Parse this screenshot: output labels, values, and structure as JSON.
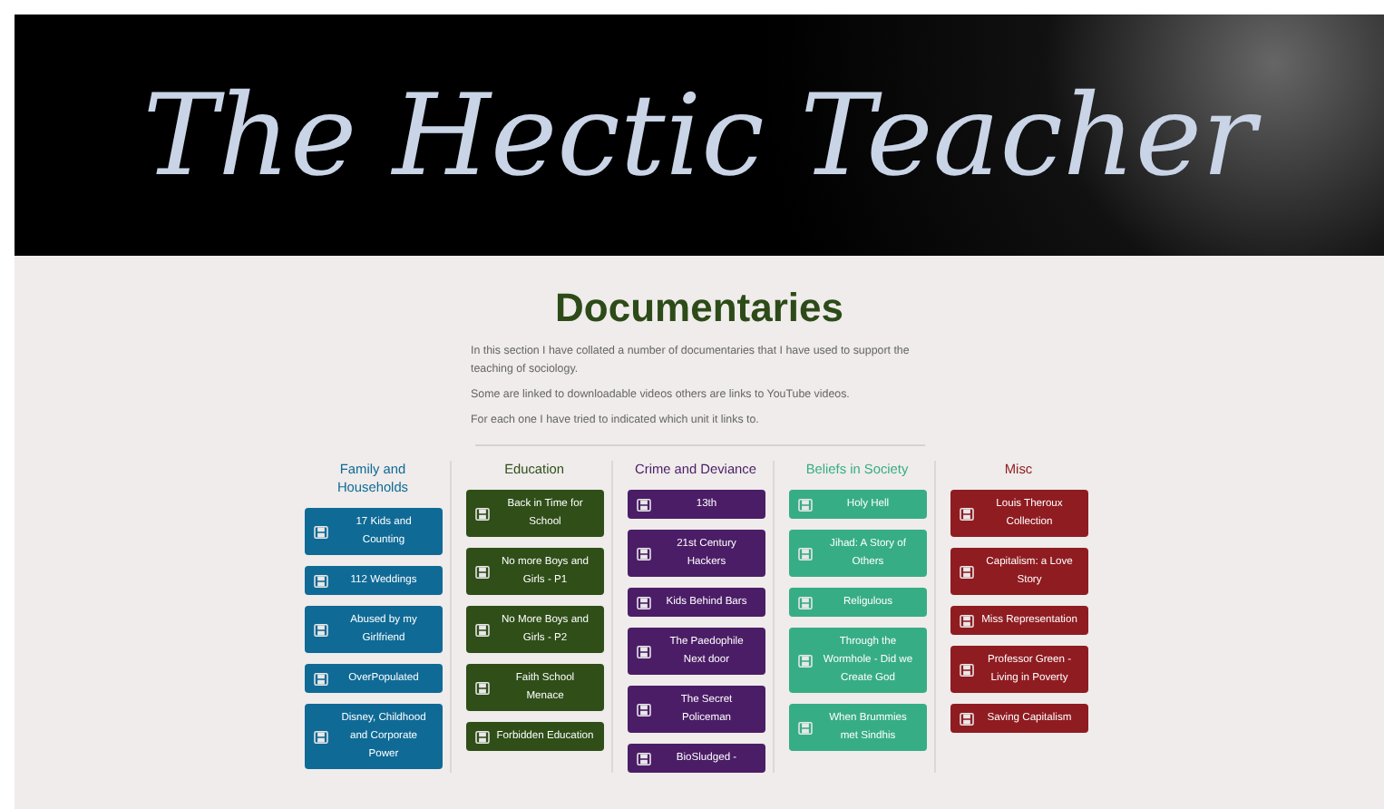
{
  "banner": {
    "title": "The Hectic Teacher"
  },
  "heading": "Documentaries",
  "intro": [
    "In this section I have collated a number of documentaries that I have used to support the teaching of sociology.",
    "Some are linked to downloadable videos others are links to YouTube videos.",
    "For each one I have tried to indicated which unit it links to."
  ],
  "columns": [
    {
      "title": "Family and Households",
      "color": "#0f6a96",
      "items": [
        "17 Kids and Counting",
        "112 Weddings",
        "Abused by my Girlfriend",
        "OverPopulated",
        "Disney, Childhood and Corporate Power"
      ]
    },
    {
      "title": "Education",
      "color": "#2f4e18",
      "items": [
        "Back in Time for School",
        "No more Boys and Girls - P1",
        "No More Boys and Girls - P2",
        "Faith School Menace",
        "Forbidden Education"
      ]
    },
    {
      "title": "Crime and Deviance",
      "color": "#4b1d66",
      "items": [
        "13th",
        "21st Century Hackers",
        "Kids Behind Bars",
        "The Paedophile Next door",
        "The Secret Policeman",
        "BioSludged -"
      ]
    },
    {
      "title": "Beliefs in Society",
      "color": "#37ad86",
      "items": [
        "Holy Hell",
        "Jihad: A Story of Others",
        "Religulous",
        "Through the Wormhole - Did we Create God",
        "When Brummies met Sindhis"
      ]
    },
    {
      "title": "Misc",
      "color": "#8f1c21",
      "items": [
        "Louis Theroux Collection",
        "Capitalism: a Love Story",
        "Miss Representation",
        "Professor Green - Living in Poverty",
        "Saving Capitalism"
      ]
    }
  ]
}
